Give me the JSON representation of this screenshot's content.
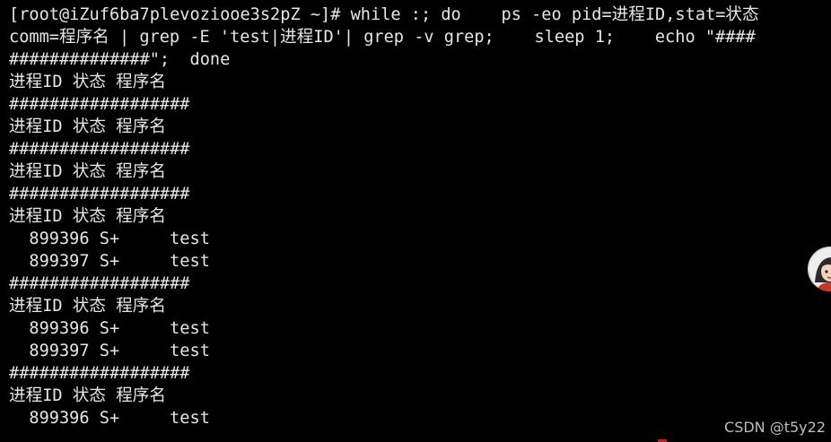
{
  "terminal": {
    "lines": [
      "[root@iZuf6ba7plevoziooe3s2pZ ~]# while :; do    ps -eo pid=进程ID,stat=状态 ",
      "comm=程序名 | grep -E 'test|进程ID'| grep -v grep;    sleep 1;    echo \"####",
      "##############\";  done",
      "进程ID 状态 程序名",
      "##################",
      "进程ID 状态 程序名",
      "##################",
      "进程ID 状态 程序名",
      "##################",
      "进程ID 状态 程序名",
      "  899396 S+     test",
      "  899397 S+     test",
      "##################",
      "进程ID 状态 程序名",
      "  899396 S+     test",
      "  899397 S+     test",
      "##################",
      "进程ID 状态 程序名",
      "  899396 S+     test"
    ]
  },
  "watermark": "CSDN @t5y22",
  "colors": {
    "background": "#000000",
    "text": "#e6e6e6",
    "watermark": "#bdbdbd"
  },
  "icons": {
    "avatar": "user-avatar-icon"
  }
}
